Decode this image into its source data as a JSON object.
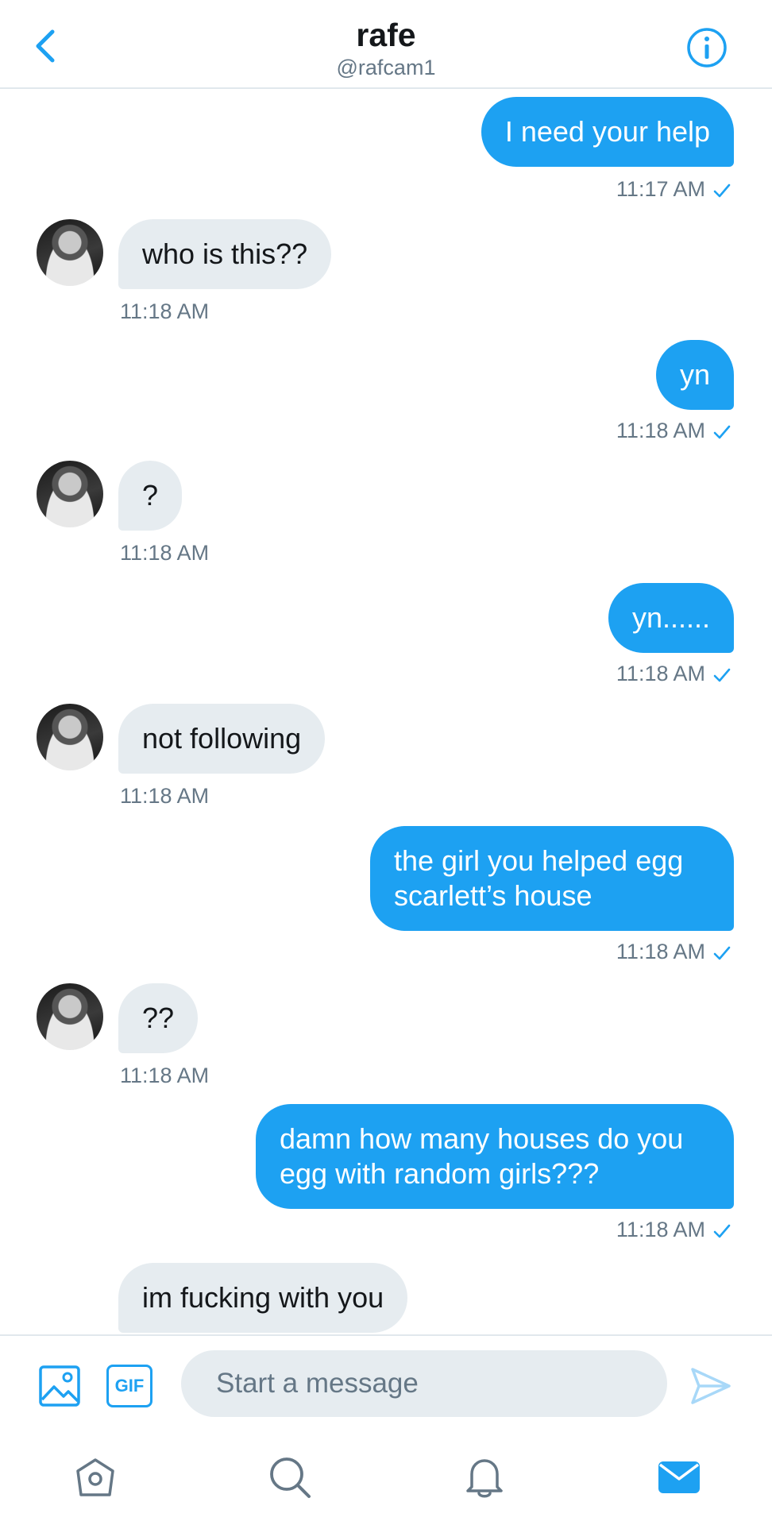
{
  "header": {
    "title": "rafe",
    "handle": "@rafcam1",
    "back_icon": "chevron-left-icon",
    "info_icon": "info-icon"
  },
  "colors": {
    "accent": "#1da1f2",
    "incoming_bubble": "#e6ecf0",
    "secondary_text": "#657786"
  },
  "messages": [
    {
      "direction": "out",
      "text": "I need your help",
      "time": "11:17 AM"
    },
    {
      "direction": "in",
      "text": "who is this??",
      "time": "11:18 AM"
    },
    {
      "direction": "out",
      "text": "yn",
      "time": "11:18 AM"
    },
    {
      "direction": "in",
      "text": "?",
      "time": "11:18 AM"
    },
    {
      "direction": "out",
      "text": "yn......",
      "time": "11:18 AM"
    },
    {
      "direction": "in",
      "text": "not following",
      "time": "11:18 AM"
    },
    {
      "direction": "out",
      "text": "the girl you helped egg scarlett’s house",
      "time": "11:18 AM"
    },
    {
      "direction": "in",
      "text": "??",
      "time": "11:18 AM"
    },
    {
      "direction": "out",
      "text": "damn how many houses do you egg with random girls???",
      "time": "11:18 AM"
    },
    {
      "direction": "in",
      "text": "im fucking with you",
      "time": ""
    }
  ],
  "composer": {
    "placeholder": "Start a message",
    "gif_label": "GIF",
    "media_icon": "image-icon",
    "send_icon": "send-icon"
  },
  "bottom_nav": [
    {
      "icon": "home-icon"
    },
    {
      "icon": "search-icon"
    },
    {
      "icon": "bell-icon"
    },
    {
      "icon": "mail-icon",
      "active": true
    }
  ]
}
